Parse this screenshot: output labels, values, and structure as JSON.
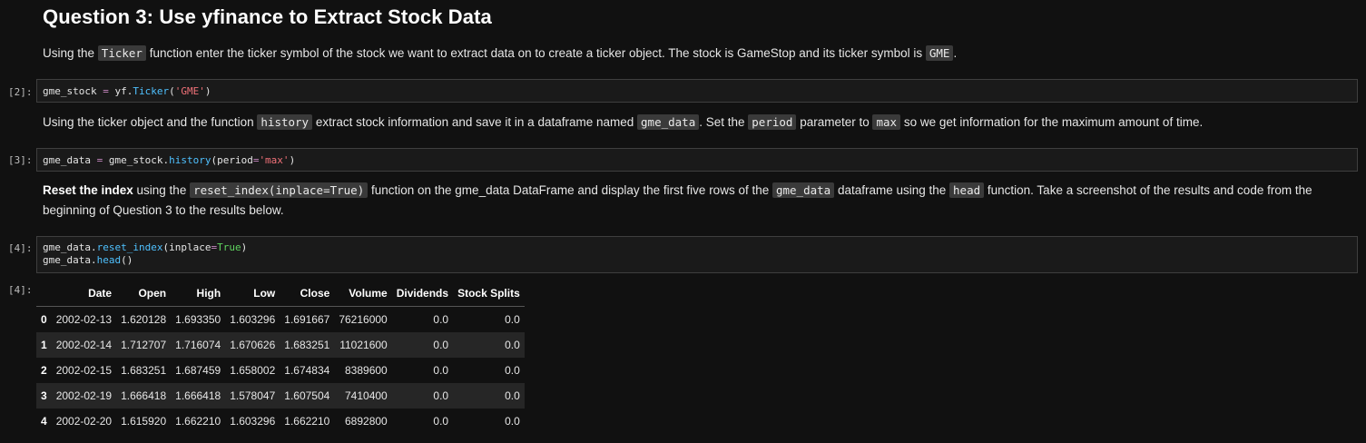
{
  "heading": "Question 3: Use yfinance to Extract Stock Data",
  "para1": {
    "t1": "Using the ",
    "c1": "Ticker",
    "t2": " function enter the ticker symbol of the stock we want to extract data on to create a ticker object. The stock is GameStop and its ticker symbol is ",
    "c2": "GME",
    "t3": "."
  },
  "cell2": {
    "prompt": "[2]:",
    "tokens": [
      "gme_stock ",
      "=",
      " yf.",
      "Ticker",
      "(",
      "'GME'",
      ")"
    ]
  },
  "para2": {
    "t1": "Using the ticker object and the function ",
    "c1": "history",
    "t2": " extract stock information and save it in a dataframe named ",
    "c2": "gme_data",
    "t3": ". Set the ",
    "c3": "period",
    "t4": " parameter to ",
    "c4": "max",
    "t5": " so we get information for the maximum amount of time."
  },
  "cell3": {
    "prompt": "[3]:",
    "tokens": [
      "gme_data ",
      "=",
      " gme_stock.",
      "history",
      "(period",
      "=",
      "'max'",
      ")"
    ]
  },
  "para3": {
    "b1": "Reset the index",
    "t1": " using the ",
    "c1": "reset_index(inplace=True)",
    "t2": " function on the gme_data DataFrame and display the first five rows of the ",
    "c2": "gme_data",
    "t3": " dataframe using the ",
    "c3": "head",
    "t4": " function. Take a screenshot of the results and code from the beginning of Question 3 to the results below."
  },
  "cell4": {
    "prompt": "[4]:",
    "line1": [
      "gme_data.",
      "reset_index",
      "(inplace",
      "=",
      "True",
      ")"
    ],
    "line2": [
      "gme_data.",
      "head",
      "()"
    ]
  },
  "output4": {
    "prompt": "[4]:",
    "columns": [
      "",
      "Date",
      "Open",
      "High",
      "Low",
      "Close",
      "Volume",
      "Dividends",
      "Stock Splits"
    ],
    "rows": [
      [
        "0",
        "2002-02-13",
        "1.620128",
        "1.693350",
        "1.603296",
        "1.691667",
        "76216000",
        "0.0",
        "0.0"
      ],
      [
        "1",
        "2002-02-14",
        "1.712707",
        "1.716074",
        "1.670626",
        "1.683251",
        "11021600",
        "0.0",
        "0.0"
      ],
      [
        "2",
        "2002-02-15",
        "1.683251",
        "1.687459",
        "1.658002",
        "1.674834",
        "8389600",
        "0.0",
        "0.0"
      ],
      [
        "3",
        "2002-02-19",
        "1.666418",
        "1.666418",
        "1.578047",
        "1.607504",
        "7410400",
        "0.0",
        "0.0"
      ],
      [
        "4",
        "2002-02-20",
        "1.615920",
        "1.662210",
        "1.603296",
        "1.662210",
        "6892800",
        "0.0",
        "0.0"
      ]
    ]
  }
}
